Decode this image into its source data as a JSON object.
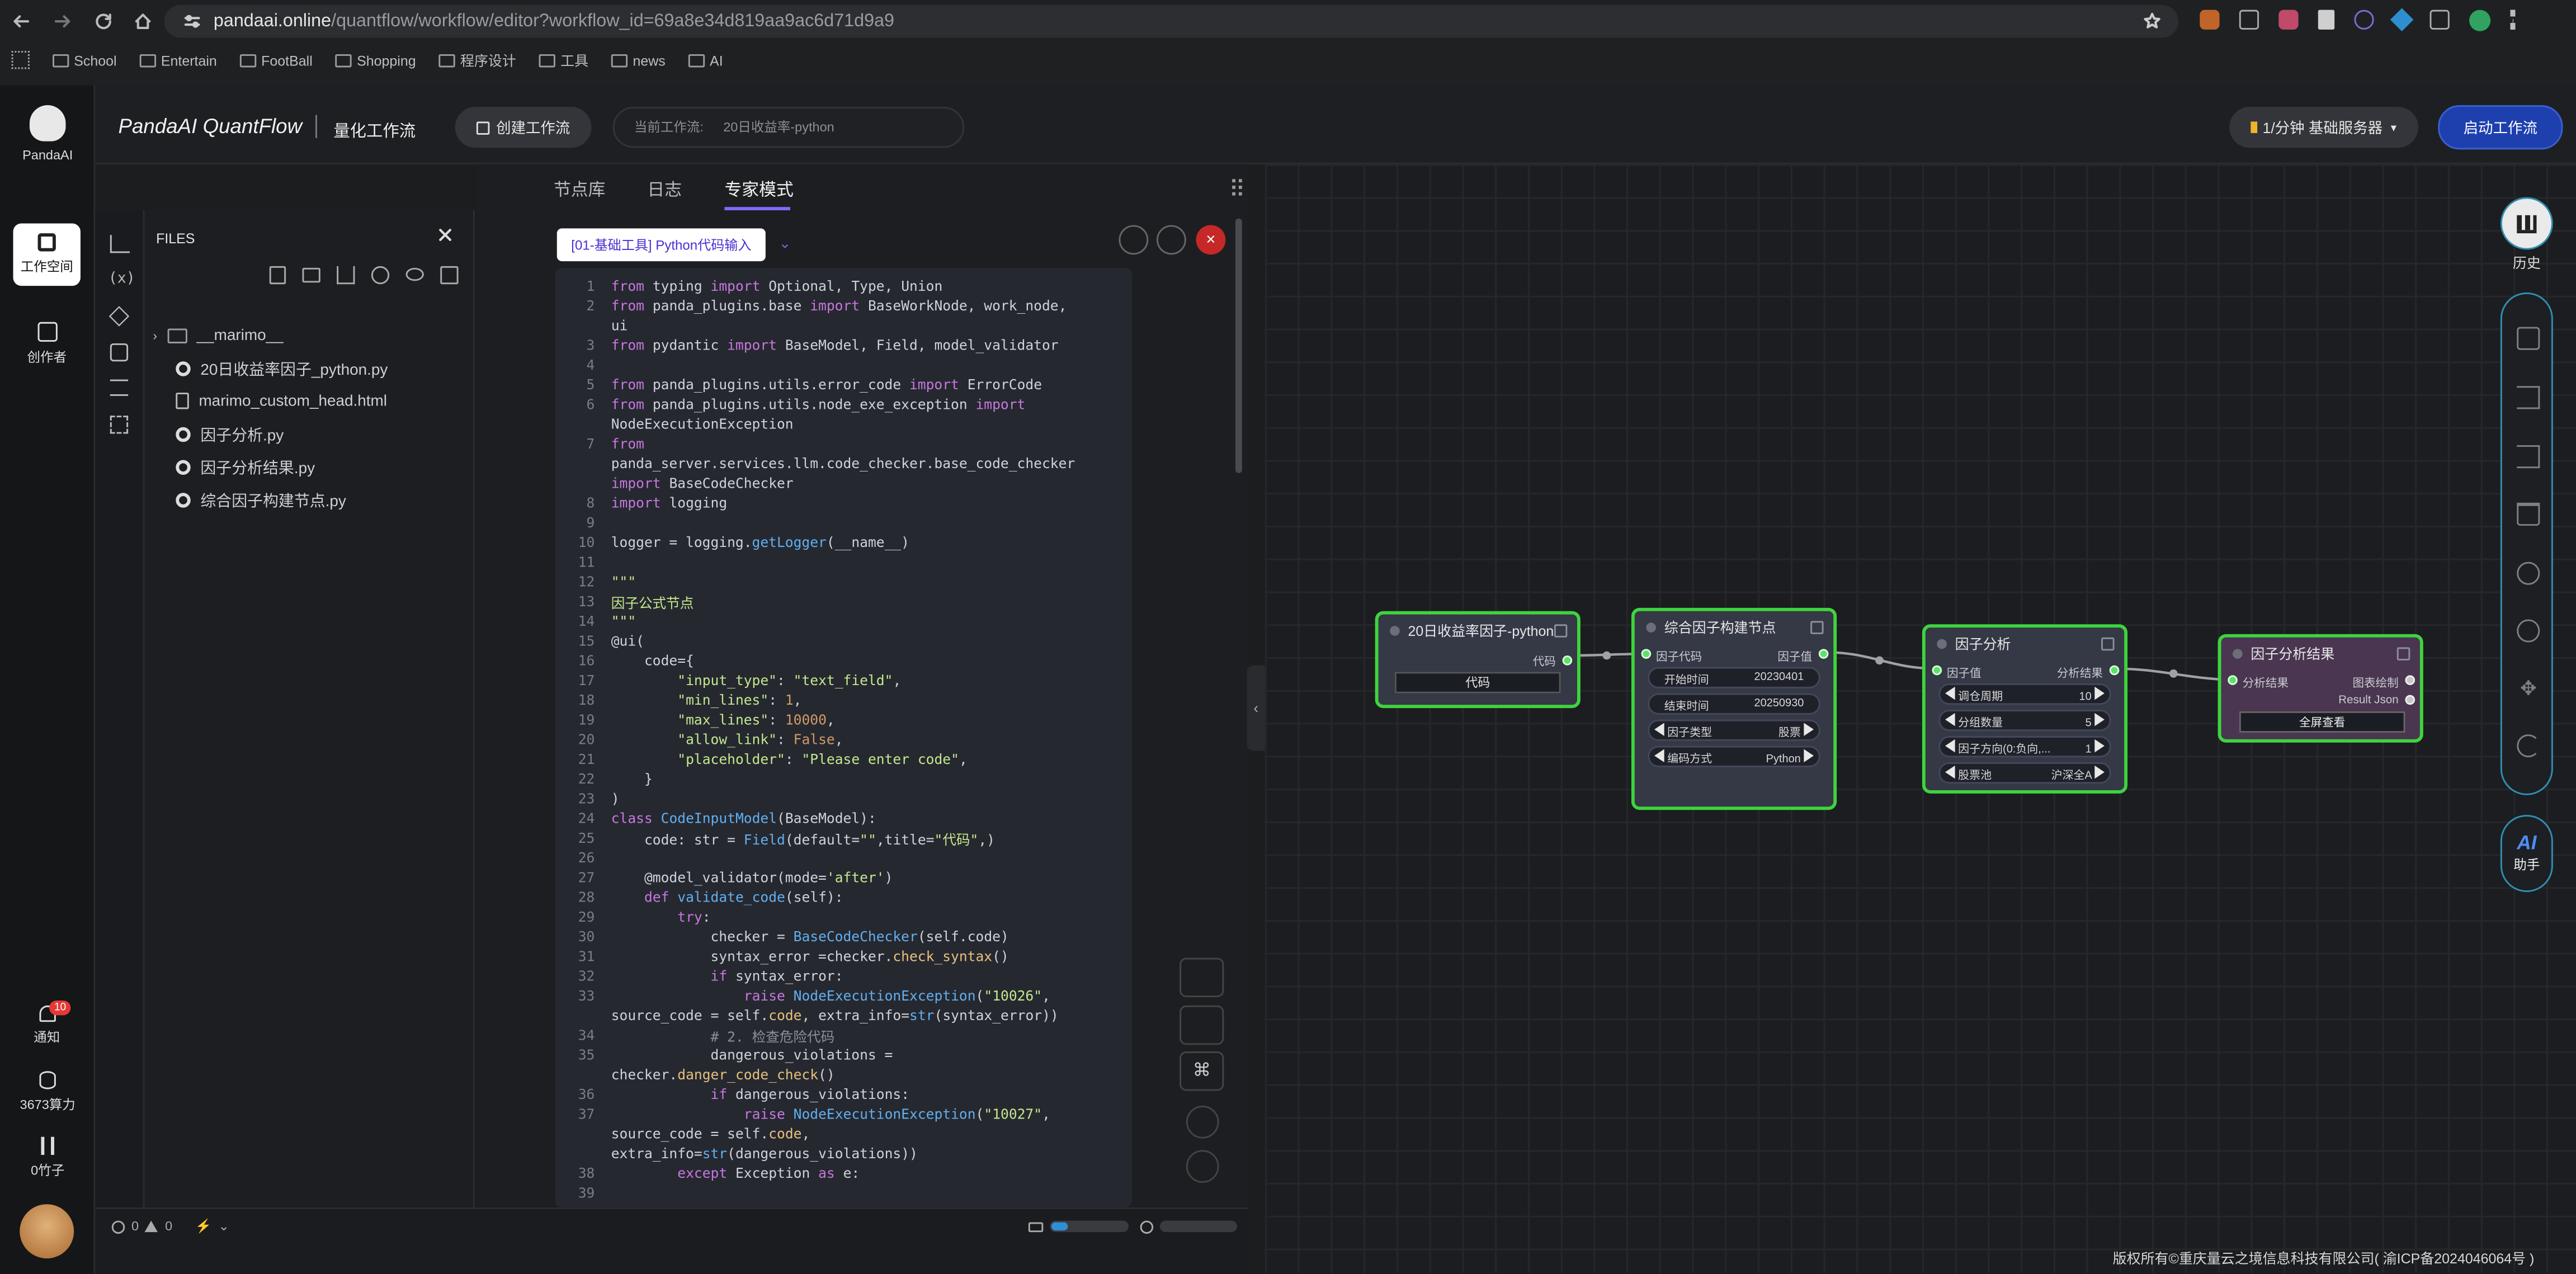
{
  "browser": {
    "url_host": "pandaai.online",
    "url_path": "/quantflow/workflow/editor?workflow_id=69a8e34d819aa9ac6d71d9a9",
    "bookmarks": [
      "School",
      "Entertain",
      "FootBall",
      "Shopping",
      "程序设计",
      "工具",
      "news",
      "AI"
    ]
  },
  "rail": {
    "logo_label": "PandaAI",
    "workspace": "工作空间",
    "creator": "创作者",
    "notify": "通知",
    "notify_badge": "10",
    "compute": "3673算力",
    "bamboo": "0竹子"
  },
  "header": {
    "brand": "PandaAI QuantFlow",
    "subtitle": "量化工作流",
    "create_btn": "创建工作流",
    "current_label": "当前工作流:",
    "current_value": "20日收益率-python",
    "server_btn": "1/分钟  基础服务器",
    "start_btn": "启动工作流"
  },
  "tabs": [
    "节点库",
    "日志",
    "专家模式"
  ],
  "files": {
    "title": "FILES",
    "items": [
      {
        "name": "__marimo__",
        "type": "folder"
      },
      {
        "name": "20日收益率因子_python.py",
        "type": "py"
      },
      {
        "name": "marimo_custom_head.html",
        "type": "html"
      },
      {
        "name": "因子分析.py",
        "type": "py"
      },
      {
        "name": "因子分析结果.py",
        "type": "py"
      },
      {
        "name": "综合因子构建节点.py",
        "type": "py"
      }
    ]
  },
  "editor": {
    "node_tag": "[01-基础工具] Python代码输入"
  },
  "code": [
    {
      "n": "1",
      "h": "<span class='k'>from</span> typing <span class='k'>import</span> Optional, Type, Union"
    },
    {
      "n": "2",
      "h": "<span class='k'>from</span> panda_plugins.base <span class='k'>import</span> BaseWorkNode, work_node,"
    },
    {
      "n": "",
      "h": "ui"
    },
    {
      "n": "3",
      "h": "<span class='k'>from</span> pydantic <span class='k'>import</span> BaseModel, Field, model_validator"
    },
    {
      "n": "4",
      "h": ""
    },
    {
      "n": "5",
      "h": "<span class='k'>from</span> panda_plugins.utils.error_code <span class='k'>import</span> ErrorCode"
    },
    {
      "n": "6",
      "h": "<span class='k'>from</span> panda_plugins.utils.node_exe_exception <span class='k'>import</span>"
    },
    {
      "n": "",
      "h": "NodeExecutionException"
    },
    {
      "n": "7",
      "h": "<span class='k'>from</span>"
    },
    {
      "n": "",
      "h": "panda_server.services.llm.code_checker.base_code_checker"
    },
    {
      "n": "",
      "h": "<span class='k'>import</span> BaseCodeChecker"
    },
    {
      "n": "8",
      "h": "<span class='k'>import</span> logging"
    },
    {
      "n": "9",
      "h": ""
    },
    {
      "n": "10",
      "h": "logger = logging.<span class='f'>getLogger</span>(__name__)"
    },
    {
      "n": "11",
      "h": ""
    },
    {
      "n": "12",
      "h": "<span class='s'>\"\"\"</span>"
    },
    {
      "n": "13",
      "h": "<span class='s'>因子公式节点</span>"
    },
    {
      "n": "14",
      "h": "<span class='s'>\"\"\"</span>"
    },
    {
      "n": "15",
      "h": "@ui("
    },
    {
      "n": "16",
      "h": "    code={"
    },
    {
      "n": "17",
      "h": "        <span class='s'>\"input_type\"</span>: <span class='s'>\"text_field\"</span>,"
    },
    {
      "n": "18",
      "h": "        <span class='s'>\"min_lines\"</span>: <span class='m'>1</span>,"
    },
    {
      "n": "19",
      "h": "        <span class='s'>\"max_lines\"</span>: <span class='m'>10000</span>,"
    },
    {
      "n": "20",
      "h": "        <span class='s'>\"allow_link\"</span>: <span class='m'>False</span>,"
    },
    {
      "n": "21",
      "h": "        <span class='s'>\"placeholder\"</span>: <span class='s'>\"Please enter code\"</span>,"
    },
    {
      "n": "22",
      "h": "    }"
    },
    {
      "n": "23",
      "h": ")"
    },
    {
      "n": "24",
      "h": "<span class='k'>class</span> <span class='f'>CodeInputModel</span>(BaseModel):"
    },
    {
      "n": "25",
      "h": "    code: str = <span class='f'>Field</span>(default=<span class='s'>\"\"</span>,title=<span class='s'>\"代码\"</span>,)"
    },
    {
      "n": "26",
      "h": ""
    },
    {
      "n": "27",
      "h": "    @model_validator(mode=<span class='s'>'after'</span>)"
    },
    {
      "n": "28",
      "h": "    <span class='k'>def</span> <span class='f'>validate_code</span>(self):"
    },
    {
      "n": "29",
      "h": "        <span class='k'>try</span>:"
    },
    {
      "n": "30",
      "h": "            checker = <span class='f'>BaseCodeChecker</span>(self.code)"
    },
    {
      "n": "31",
      "h": "            syntax_error =checker.<span class='y'>check_syntax</span>()"
    },
    {
      "n": "32",
      "h": "            <span class='k'>if</span> syntax_error:"
    },
    {
      "n": "33",
      "h": "                <span class='k'>raise</span> <span class='f'>NodeExecutionException</span>(<span class='s'>\"10026\"</span>,"
    },
    {
      "n": "",
      "h": "source_code = self.<span class='y'>code</span>, extra_info=<span class='f'>str</span>(syntax_error))"
    },
    {
      "n": "34",
      "h": "            <span class='c'># 2. 检查危险代码</span>"
    },
    {
      "n": "35",
      "h": "            dangerous_violations ="
    },
    {
      "n": "",
      "h": "checker.<span class='y'>danger_code_check</span>()"
    },
    {
      "n": "36",
      "h": "            <span class='k'>if</span> dangerous_violations:"
    },
    {
      "n": "37",
      "h": "                <span class='k'>raise</span> <span class='f'>NodeExecutionException</span>(<span class='s'>\"10027\"</span>,"
    },
    {
      "n": "",
      "h": "source_code = self.<span class='y'>code</span>,"
    },
    {
      "n": "",
      "h": "extra_info=<span class='f'>str</span>(dangerous_violations))"
    },
    {
      "n": "38",
      "h": "        <span class='k'>except</span> Exception <span class='k'>as</span> e:"
    },
    {
      "n": "39",
      "h": ""
    }
  ],
  "status": {
    "errors": "0",
    "warnings": "0"
  },
  "nodes": {
    "n1": {
      "title": "20日收益率因子-python",
      "out": "代码",
      "btn": "代码"
    },
    "n2": {
      "title": "综合因子构建节点",
      "in": "因子代码",
      "out": "因子值",
      "start_label": "开始时间",
      "start_value": "20230401",
      "end_label": "结束时间",
      "end_value": "20250930",
      "type_label": "因子类型",
      "type_value": "股票",
      "enc_label": "编码方式",
      "enc_value": "Python"
    },
    "n3": {
      "title": "因子分析",
      "in": "因子值",
      "out": "分析结果",
      "f1_label": "调仓周期",
      "f1_value": "10",
      "f2_label": "分组数量",
      "f2_value": "5",
      "f3_label": "因子方向(0:负向,...",
      "f3_value": "1",
      "f4_label": "股票池",
      "f4_value": "沪深全A"
    },
    "n4": {
      "title": "因子分析结果",
      "in": "分析结果",
      "out1": "图表绘制",
      "out2": "Result Json",
      "btn": "全屏查看"
    }
  },
  "right": {
    "history": "历史",
    "ai_label": "AI",
    "ai_sub": "助手"
  },
  "footer": "版权所有©重庆量云之境信息科技有限公司( 渝ICP备2024046064号 )",
  "colors": {
    "node_border": "#3ed43e",
    "accent": "#1e40af",
    "tab_active": "#7c6cff"
  }
}
